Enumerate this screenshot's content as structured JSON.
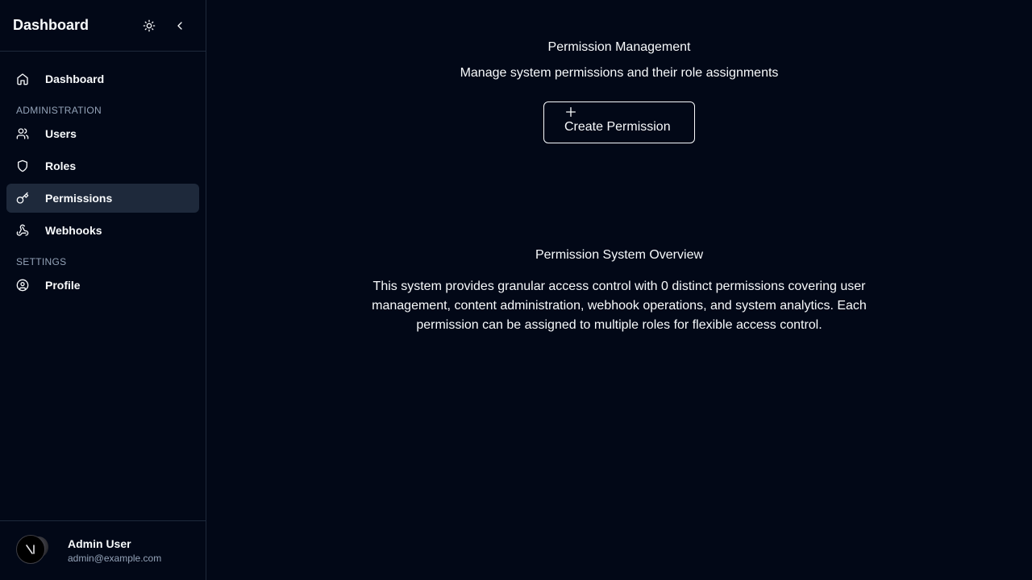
{
  "sidebar": {
    "title": "Dashboard",
    "nav": {
      "dashboard": "Dashboard",
      "section_admin": "ADMINISTRATION",
      "users": "Users",
      "roles": "Roles",
      "permissions": "Permissions",
      "webhooks": "Webhooks",
      "section_settings": "SETTINGS",
      "profile": "Profile"
    },
    "active_item": "Permissions",
    "user": {
      "name": "Admin User",
      "email": "admin@example.com"
    }
  },
  "main": {
    "title": "Permission Management",
    "subtitle": "Manage system permissions and their role assignments",
    "create_button_label": "Create Permission",
    "overview_title": "Permission System Overview",
    "overview_text": "This system provides granular access control with 0 distinct permissions covering user management, content administration, webhook operations, and system analytics. Each permission can be assigned to multiple roles for flexible access control."
  },
  "icons": {
    "theme_toggle": "sun-icon",
    "collapse": "chevron-left-icon",
    "dashboard": "home-icon",
    "users": "users-icon",
    "roles": "shield-icon",
    "permissions": "key-icon",
    "webhooks": "webhook-icon",
    "profile": "user-circle-icon",
    "create": "plus-icon"
  },
  "colors": {
    "background": "#020817",
    "border": "#1e293b",
    "active_bg": "#1e293b",
    "muted_text": "#94a3b8",
    "text": "#f8fafc"
  }
}
